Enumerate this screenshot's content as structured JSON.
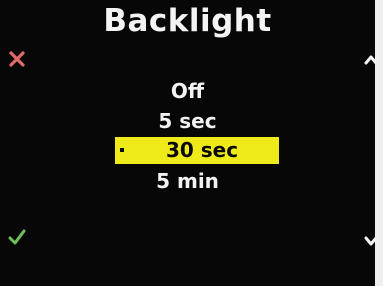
{
  "screen": {
    "title": "Backlight",
    "menu": {
      "items": [
        {
          "label": "Off",
          "selected": false
        },
        {
          "label": "5 sec",
          "selected": false
        },
        {
          "label": "30 sec",
          "selected": true
        },
        {
          "label": "5 min",
          "selected": false
        }
      ]
    },
    "icons": {
      "cancel": "close-icon",
      "confirm": "check-icon",
      "scroll_up": "chevron-up-icon",
      "scroll_down": "chevron-down-icon"
    },
    "colors": {
      "background": "#070707",
      "text": "#f2f2f2",
      "highlight": "#efea1a",
      "cancel": "#e36a6a",
      "confirm": "#6fbf5b"
    }
  }
}
